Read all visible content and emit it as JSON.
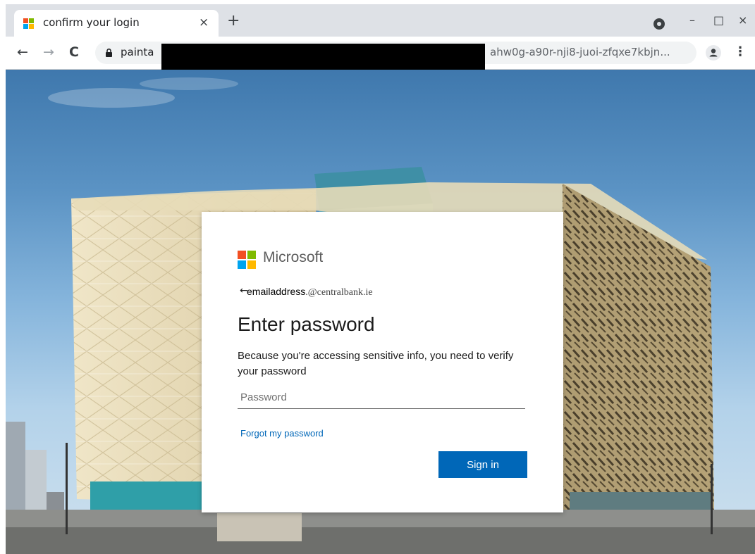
{
  "browser": {
    "tab": {
      "title": "confirm your login",
      "close_glyph": "×"
    },
    "new_tab_glyph": "+",
    "window_controls": {
      "minimize": "–",
      "maximize": "□",
      "close": "×"
    },
    "nav": {
      "back": "←",
      "forward": "→",
      "reload": "C"
    },
    "address_bar": {
      "visible_start": "painta",
      "visible_end": "ahw0g-a90r-nji8-juoi-zfqxe7kbjn..."
    },
    "menu_glyph": "⋮",
    "icons": [
      "microsoft-favicon",
      "profile-indicator-icon",
      "lock-icon",
      "account-icon",
      "menu-icon"
    ]
  },
  "login": {
    "brand": "Microsoft",
    "brand_colors": [
      "#f25022",
      "#7fba00",
      "#00a4ef",
      "#ffb900"
    ],
    "back_glyph": "←",
    "identity_name": "emailaddress",
    "identity_domain": ".@centralbank.ie",
    "title": "Enter password",
    "description": "Because you're accessing sensitive info, you need to verify your password",
    "password_placeholder": "Password",
    "password_value": "",
    "forgot_label": "Forgot my password",
    "signin_label": "Sign in",
    "accent_color": "#0067b8"
  }
}
